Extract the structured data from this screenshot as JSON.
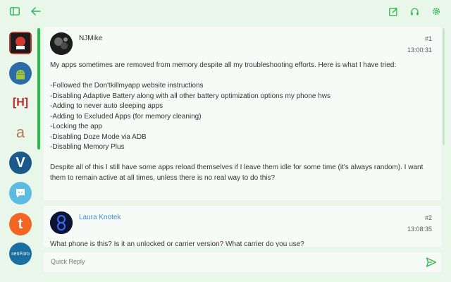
{
  "colors": {
    "accent": "#2eb84b",
    "background": "#e8f7ea",
    "card": "#f7fbf7",
    "link": "#3a8fd8"
  },
  "topbar": {
    "icons": [
      "sidebar-toggle-icon",
      "back-arrow-icon",
      "edit-icon",
      "headset-icon",
      "gear-icon"
    ]
  },
  "sidebar": {
    "items": [
      {
        "icon": "forum-icon-1",
        "label": ""
      },
      {
        "icon": "android-icon",
        "label": ""
      },
      {
        "icon": "h-icon",
        "label": "[H]"
      },
      {
        "icon": "a-icon",
        "label": "a"
      },
      {
        "icon": "v-icon",
        "label": "V"
      },
      {
        "icon": "chat-icon",
        "label": ""
      },
      {
        "icon": "t-icon",
        "label": "t"
      },
      {
        "icon": "xenforo-icon",
        "label": "xenForo"
      }
    ]
  },
  "posts": [
    {
      "username": "NJMike",
      "number": "#1",
      "time": "13:00:31",
      "paragraph1": "My apps sometimes are removed from memory despite all my troubleshooting efforts. Here is what I have tried:",
      "items": [
        "-Followed the Don'tkillmyapp website instructions",
        "-Disabling Adaptive Battery along with all other battery optimization options my phone hws",
        "-Adding to never auto sleeping apps",
        "-Adding to Excluded Apps (for memory cleaning)",
        "-Locking the app",
        "-Disabling Doze Mode via ADB",
        "-Disabling Memory Plus"
      ],
      "paragraph2": "Despite all of this I still have some apps reload themselves if I leave them idle for some time (it's always random). I want them to remain active at all times, unless there is no real way to do this?"
    },
    {
      "username": "Laura Knotek",
      "number": "#2",
      "time": "13:08:35",
      "text": "What phone is this? Is it an unlocked or carrier version? What carrier do you use?"
    }
  ],
  "quick_reply": {
    "placeholder": "Quick Reply"
  }
}
